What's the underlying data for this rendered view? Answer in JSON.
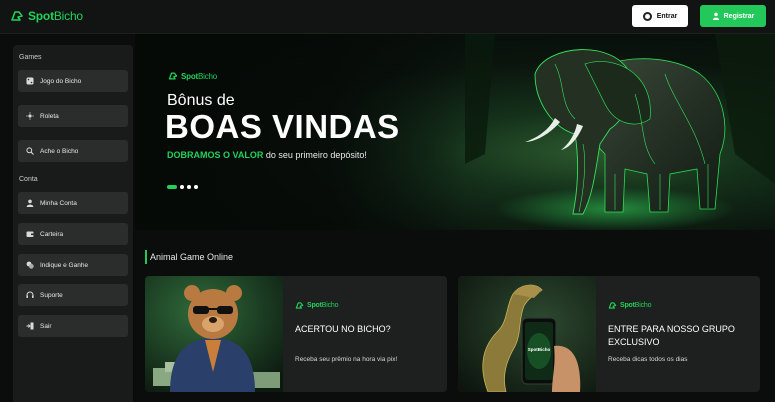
{
  "brand": {
    "name_bold": "Spot",
    "name_thin": "Bicho",
    "color": "#22d15a"
  },
  "header": {
    "login_label": "Entrar",
    "register_label": "Registrar"
  },
  "sidebar": {
    "games_heading": "Games",
    "games": [
      {
        "label": "Jogo do Bicho",
        "icon": "dice-icon"
      },
      {
        "label": "Roleta",
        "icon": "roulette-icon"
      },
      {
        "label": "Ache o Bicho",
        "icon": "search-icon"
      }
    ],
    "account_heading": "Conta",
    "account": [
      {
        "label": "Minha Conta",
        "icon": "user-icon"
      },
      {
        "label": "Carteira",
        "icon": "wallet-icon"
      },
      {
        "label": "Indique e Ganhe",
        "icon": "coins-icon"
      },
      {
        "label": "Suporte",
        "icon": "support-icon"
      },
      {
        "label": "Sair",
        "icon": "logout-icon"
      }
    ]
  },
  "hero": {
    "line1": "Bônus de",
    "line2": "BOAS VINDAS",
    "highlight": "DOBRAMOS O VALOR",
    "rest": " do seu primeiro depósito!",
    "slides": 4,
    "active_slide": 1
  },
  "section": {
    "title": "Animal Game Online"
  },
  "cards": [
    {
      "title": "ACERTOU NO BICHO?",
      "subtitle": "Receba seu prêmio na hora via pix!"
    },
    {
      "title": "ENTRE PARA NOSSO GRUPO EXCLUSIVO",
      "subtitle": "Receba dicas todos os dias",
      "phone_brand": "SpotBicho"
    }
  ]
}
